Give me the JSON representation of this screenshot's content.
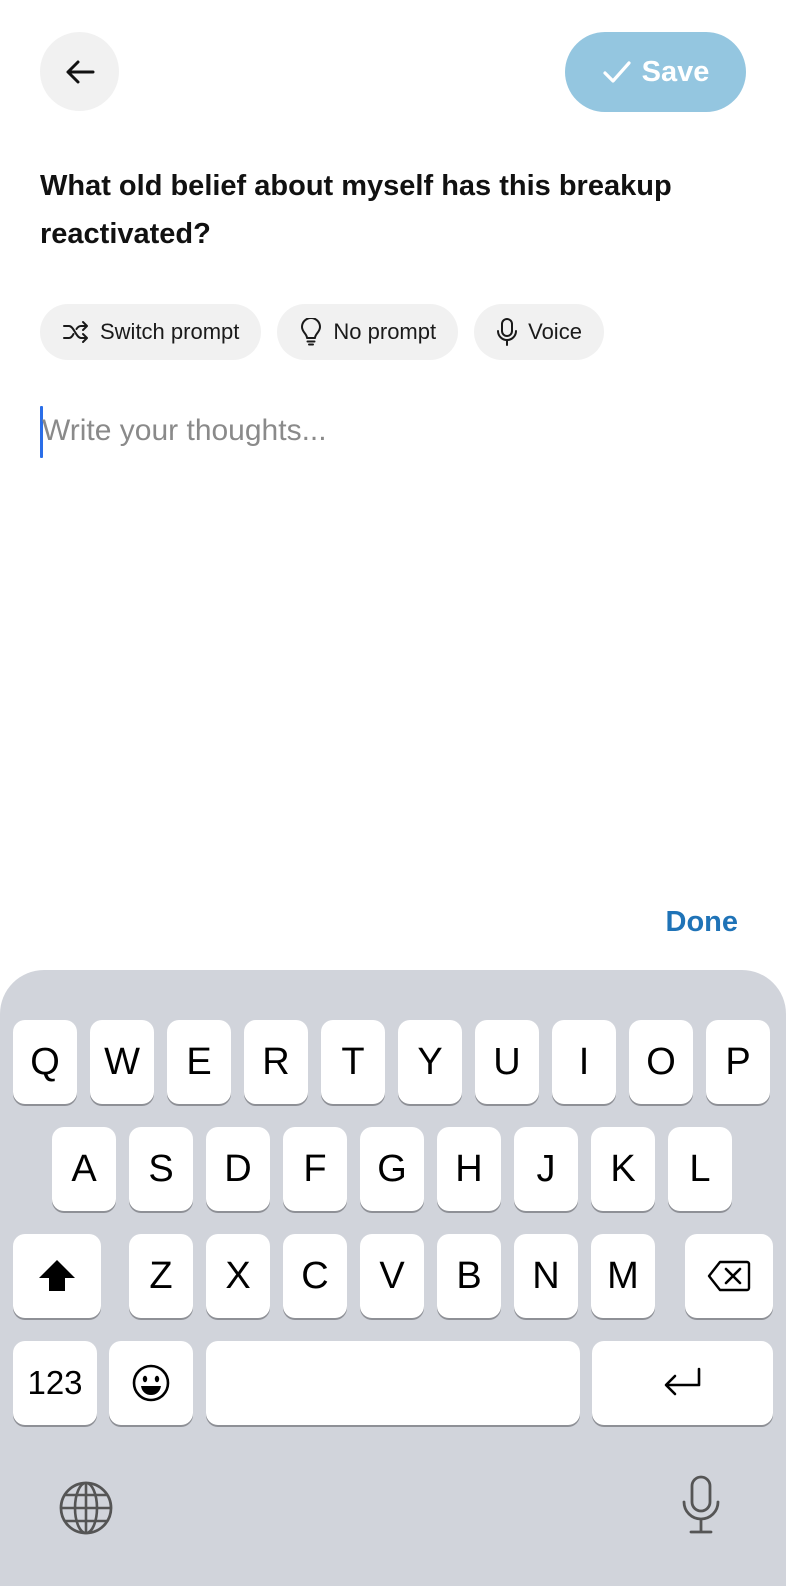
{
  "header": {
    "back_icon": "arrow-left-icon",
    "save_label": "Save",
    "save_icon": "checkmark-icon",
    "save_color": "#94c6e0"
  },
  "prompt": {
    "title": "What old belief about myself has this breakup reactivated?"
  },
  "chips": [
    {
      "label": "Switch prompt",
      "icon": "shuffle-icon"
    },
    {
      "label": "No prompt",
      "icon": "lightbulb-icon"
    },
    {
      "label": "Voice",
      "icon": "microphone-icon"
    }
  ],
  "editor": {
    "placeholder": "Write your thoughts...",
    "value": ""
  },
  "accessory": {
    "done_label": "Done",
    "done_color": "#1f73b7"
  },
  "keyboard": {
    "row1": [
      "Q",
      "W",
      "E",
      "R",
      "T",
      "Y",
      "U",
      "I",
      "O",
      "P"
    ],
    "row2": [
      "A",
      "S",
      "D",
      "F",
      "G",
      "H",
      "J",
      "K",
      "L"
    ],
    "row3": [
      "Z",
      "X",
      "C",
      "V",
      "B",
      "N",
      "M"
    ],
    "numbers_label": "123",
    "icons": {
      "shift": "shift-icon",
      "delete": "backspace-icon",
      "emoji": "emoji-icon",
      "return": "return-icon",
      "globe": "globe-icon",
      "dictation": "microphone-icon"
    }
  }
}
